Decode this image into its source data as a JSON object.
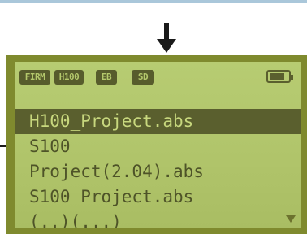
{
  "status_bar": {
    "firm": "FIRM",
    "h100": "H100",
    "eb": "EB",
    "sd": "SD"
  },
  "files": [
    {
      "name": "H100_Project.abs",
      "selected": true
    },
    {
      "name": "S100",
      "selected": false
    },
    {
      "name": "Project(2.04).abs",
      "selected": false
    },
    {
      "name": "S100_Project.abs",
      "selected": false
    },
    {
      "name": "(..)(...)",
      "selected": false
    }
  ],
  "colors": {
    "lcd": "#b4c86c",
    "highlight": "#5a5f2e",
    "arrow": "#1a1a1a"
  }
}
